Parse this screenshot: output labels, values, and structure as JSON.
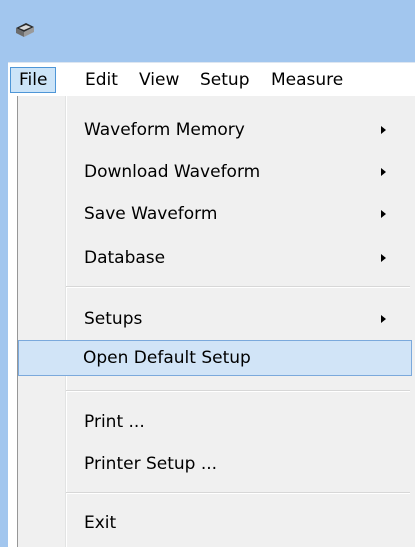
{
  "menubar": {
    "items": [
      {
        "label": "File",
        "active": true
      },
      {
        "label": "Edit",
        "active": false
      },
      {
        "label": "View",
        "active": false
      },
      {
        "label": "Setup",
        "active": false
      },
      {
        "label": "Measure",
        "active": false
      }
    ]
  },
  "file_menu": {
    "items": [
      {
        "label": "Waveform Memory",
        "submenu": true
      },
      {
        "label": "Download Waveform",
        "submenu": true
      },
      {
        "label": "Save Waveform",
        "submenu": true
      },
      {
        "label": "Database",
        "submenu": true
      },
      {
        "label": "Setups",
        "submenu": true
      },
      {
        "label": "Open Default Setup",
        "submenu": false,
        "highlighted": true
      },
      {
        "label": "Print ...",
        "submenu": false
      },
      {
        "label": "Printer Setup ...",
        "submenu": false
      },
      {
        "label": "Exit",
        "submenu": false
      }
    ]
  },
  "icons": {
    "app": "oscilloscope-app-icon",
    "submenu_arrow": "chevron-right-icon"
  },
  "colors": {
    "titlebar": "#a2c6ee",
    "menu_background": "#f0f0f0",
    "highlight_fill": "#d1e4f7",
    "highlight_border": "#7ba9dc",
    "active_menu_fill": "#cce4f8",
    "active_menu_border": "#4e96d7"
  }
}
